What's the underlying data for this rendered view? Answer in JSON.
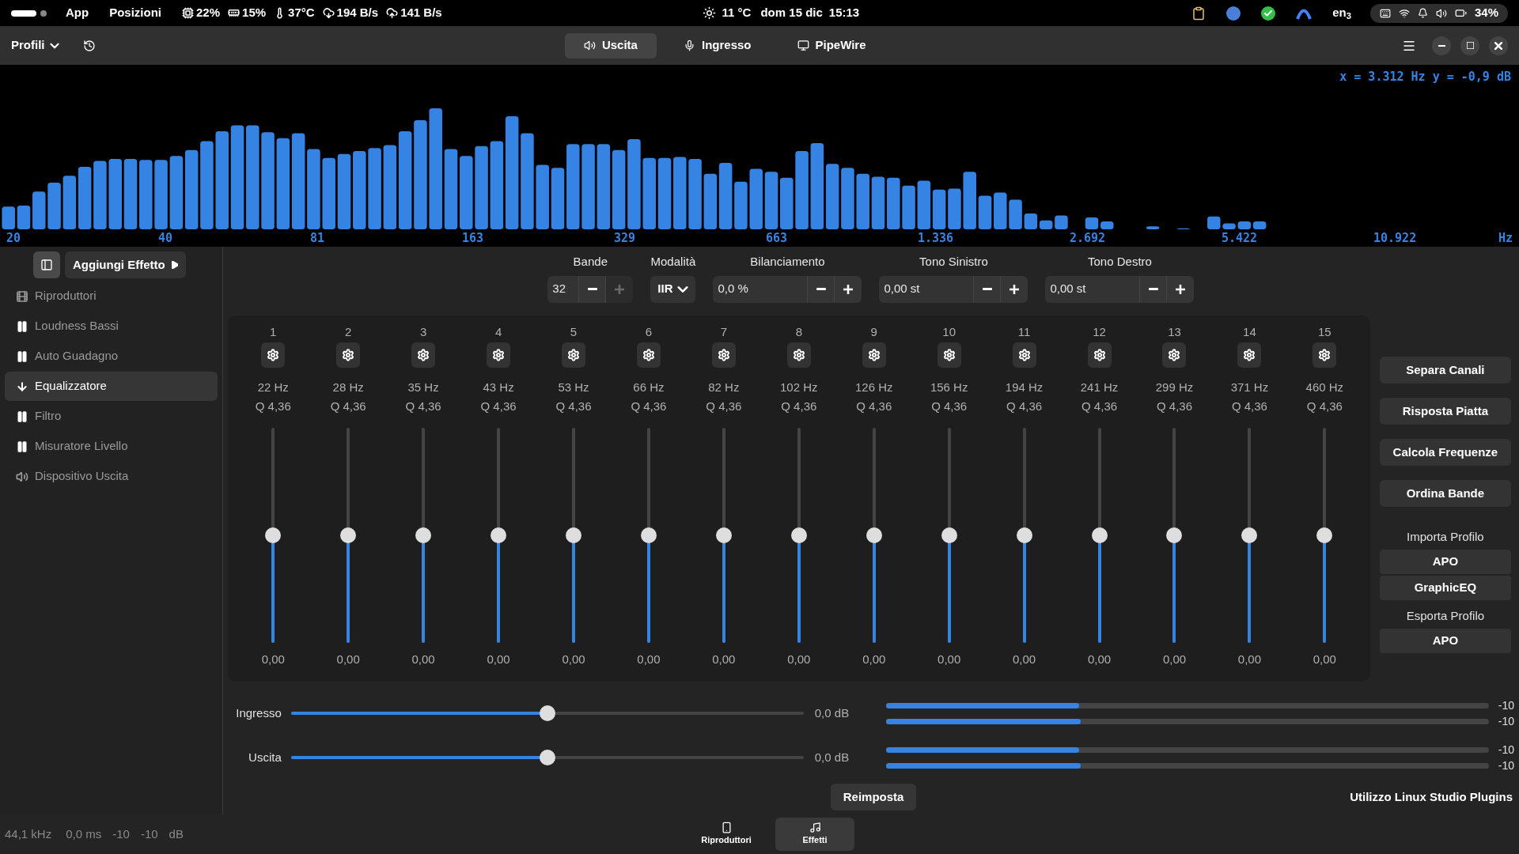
{
  "top_bar": {
    "menus": [
      "App",
      "Posizioni"
    ],
    "indicators": [
      {
        "kind": "cpu",
        "text": "22%"
      },
      {
        "kind": "memory",
        "text": "15%"
      },
      {
        "kind": "temperature",
        "text": "37°C"
      },
      {
        "kind": "download",
        "text": "194 B/s"
      },
      {
        "kind": "upload",
        "text": "141 B/s"
      }
    ],
    "weather": "11 °C",
    "date": "dom 15 dic",
    "time": "15:13",
    "keyboard": "en$_{3}$",
    "battery": "34%"
  },
  "header": {
    "profiles": "Profili",
    "tabs": [
      {
        "label": "Uscita",
        "kind": "output",
        "selected": true
      },
      {
        "label": "Ingresso",
        "kind": "input",
        "selected": false
      },
      {
        "label": "PipeWire",
        "kind": "pipewire",
        "selected": false
      }
    ]
  },
  "spectrum": {
    "readout": "x = 3.312 Hz y = -0,9 dB",
    "axis_labels": [
      "20",
      "40",
      "81",
      "163",
      "329",
      "663",
      "1.336",
      "2.692",
      "5.422",
      "10.922"
    ],
    "unit": "Hz"
  },
  "sidebar": {
    "add_effect": "Aggiungi Effetto",
    "items": [
      {
        "label": "Riproduttori",
        "kind": "players",
        "selected": false
      },
      {
        "label": "Loudness Bassi",
        "kind": "effect",
        "selected": false
      },
      {
        "label": "Auto Guadagno",
        "kind": "effect",
        "selected": false
      },
      {
        "label": "Equalizzatore",
        "kind": "effect",
        "selected": true
      },
      {
        "label": "Filtro",
        "kind": "effect",
        "selected": false
      },
      {
        "label": "Misuratore Livello",
        "kind": "effect",
        "selected": false
      },
      {
        "label": "Dispositivo Uscita",
        "kind": "output",
        "selected": false
      }
    ]
  },
  "controls": [
    {
      "label": "Bande",
      "kind": "spin",
      "value": "32",
      "increase_disabled": true
    },
    {
      "label": "Modalità",
      "kind": "dropdown",
      "value": "IIR"
    },
    {
      "label": "Bilanciamento",
      "kind": "field",
      "value": "0,0 %",
      "increase_disabled": false
    },
    {
      "label": "Tono Sinistro",
      "kind": "field",
      "value": "0,00 st",
      "increase_disabled": false
    },
    {
      "label": "Tono Destro",
      "kind": "field",
      "value": "0,00 st",
      "increase_disabled": false
    }
  ],
  "bands": [
    {
      "number": "1",
      "frequency": "22 Hz",
      "q": "Q 4,36",
      "level": 0.5,
      "gain": "0,00"
    },
    {
      "number": "2",
      "frequency": "28 Hz",
      "q": "Q 4,36",
      "level": 0.5,
      "gain": "0,00"
    },
    {
      "number": "3",
      "frequency": "35 Hz",
      "q": "Q 4,36",
      "level": 0.5,
      "gain": "0,00"
    },
    {
      "number": "4",
      "frequency": "43 Hz",
      "q": "Q 4,36",
      "level": 0.5,
      "gain": "0,00"
    },
    {
      "number": "5",
      "frequency": "53 Hz",
      "q": "Q 4,36",
      "level": 0.5,
      "gain": "0,00"
    },
    {
      "number": "6",
      "frequency": "66 Hz",
      "q": "Q 4,36",
      "level": 0.5,
      "gain": "0,00"
    },
    {
      "number": "7",
      "frequency": "82 Hz",
      "q": "Q 4,36",
      "level": 0.5,
      "gain": "0,00"
    },
    {
      "number": "8",
      "frequency": "102 Hz",
      "q": "Q 4,36",
      "level": 0.5,
      "gain": "0,00"
    },
    {
      "number": "9",
      "frequency": "126 Hz",
      "q": "Q 4,36",
      "level": 0.5,
      "gain": "0,00"
    },
    {
      "number": "10",
      "frequency": "156 Hz",
      "q": "Q 4,36",
      "level": 0.5,
      "gain": "0,00"
    },
    {
      "number": "11",
      "frequency": "194 Hz",
      "q": "Q 4,36",
      "level": 0.5,
      "gain": "0,00"
    },
    {
      "number": "12",
      "frequency": "241 Hz",
      "q": "Q 4,36",
      "level": 0.5,
      "gain": "0,00"
    },
    {
      "number": "13",
      "frequency": "299 Hz",
      "q": "Q 4,36",
      "level": 0.5,
      "gain": "0,00"
    },
    {
      "number": "14",
      "frequency": "371 Hz",
      "q": "Q 4,36",
      "level": 0.5,
      "gain": "0,00"
    },
    {
      "number": "15",
      "frequency": "460 Hz",
      "q": "Q 4,36",
      "level": 0.5,
      "gain": "0,00"
    }
  ],
  "side_actions": [
    {
      "kind": "button",
      "text": "Separa Canali"
    },
    {
      "kind": "button",
      "text": "Risposta Piatta"
    },
    {
      "kind": "button",
      "text": "Calcola Frequenze"
    },
    {
      "kind": "button",
      "text": "Ordina Bande"
    },
    {
      "kind": "heading",
      "text": "Importa Profilo"
    },
    {
      "kind": "group_button",
      "text": "APO"
    },
    {
      "kind": "group_button",
      "text": "GraphicEQ"
    },
    {
      "kind": "heading",
      "text": "Esporta Profilo"
    },
    {
      "kind": "group_button",
      "text": "APO"
    }
  ],
  "gains": [
    {
      "label": "Ingresso",
      "level": 0.5,
      "reading": "0,0 dB",
      "meters": [
        {
          "level": 0.32,
          "reading": "-10"
        },
        {
          "level": 0.323,
          "reading": "-10"
        }
      ]
    },
    {
      "label": "Uscita",
      "level": 0.5,
      "reading": "0,0 dB",
      "meters": [
        {
          "level": 0.32,
          "reading": "-10"
        },
        {
          "level": 0.323,
          "reading": "-10"
        }
      ]
    }
  ],
  "reset": "Reimposta",
  "credits": "Utilizzo Linux Studio Plugins",
  "status": [
    "44,1 kHz",
    "0,0 ms",
    "-10",
    "-10",
    "dB"
  ],
  "bottom_tabs": [
    {
      "label": "Riproduttori",
      "kind": "players",
      "selected": false
    },
    {
      "label": "Effetti",
      "kind": "effects",
      "selected": true
    }
  ]
}
